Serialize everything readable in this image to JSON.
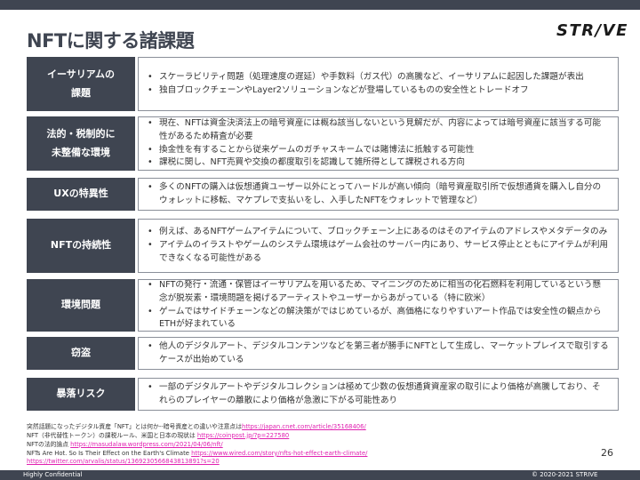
{
  "header": {
    "title": "NFTに関する諸課題",
    "logo": "STR/VE"
  },
  "rows": [
    {
      "label_lines": [
        "イーサリアムの",
        "課題"
      ],
      "bullets": [
        "スケーラビリティ問題（処理速度の遅延）や手数料（ガス代）の高騰など、イーサリアムに起因した課題が表出",
        "独自ブロックチェーンやLayer2ソリューションなどが登場しているものの安全性とトレードオフ"
      ]
    },
    {
      "label_lines": [
        "法的・税制的に",
        "未整備な環境"
      ],
      "bullets": [
        "現在、NFTは資金決済法上の暗号資産には概ね該当しないという見解だが、内容によっては暗号資産に該当する可能性があるため精査が必要",
        "換金性を有することから従来ゲームのガチャスキームでは賭博法に抵触する可能性",
        "課税に関し、NFT売買や交換の都度取引を認識して雑所得として課税される方向"
      ]
    },
    {
      "label_lines": [
        "UXの特異性"
      ],
      "bullets": [
        "多くのNFTの購入は仮想通貨ユーザー以外にとってハードルが高い傾向（暗号資産取引所で仮想通貨を購入し自分のウォレットに移転、マケプレで支払いをし、入手したNFTをウォレットで管理など）"
      ]
    },
    {
      "label_lines": [
        "NFTの持続性"
      ],
      "bullets": [
        "例えば、あるNFTゲームアイテムについて、ブロックチェーン上にあるのはそのアイテムのアドレスやメタデータのみ",
        "アイテムのイラストやゲームのシステム環境はゲーム会社のサーバー内にあり、サービス停止とともにアイテムが利用できなくなる可能性がある"
      ]
    },
    {
      "label_lines": [
        "環境問題"
      ],
      "bullets": [
        "NFTの発行・流通・保管はイーサリアムを用いるため、マイニングのために相当の化石燃料を利用しているという懸念が脱炭素・環境問題を掲げるアーティストやユーザーからあがっている（特に欧米）",
        "ゲームではサイドチェーンなどの解決策がではじめているが、高価格になりやすいアート作品では安全性の観点からETHが好まれている"
      ]
    },
    {
      "label_lines": [
        "窃盗"
      ],
      "bullets": [
        "他人のデジタルアート、デジタルコンテンツなどを第三者が勝手にNFTとして生成し、マーケットプレイスで取引するケースが出始めている"
      ]
    },
    {
      "label_lines": [
        "暴落リスク"
      ],
      "bullets": [
        "一部のデジタルアートやデジタルコレクションは極めて少数の仮想通貨資産家の取引により価格が高騰しており、それらのプレイヤーの離散により価格が急激に下がる可能性あり"
      ]
    }
  ],
  "footnotes": [
    {
      "text": "突然話題になったデジタル資産「NFT」とは何か--暗号資産との違いや注意点は",
      "link": "https://japan.cnet.com/article/35168406/"
    },
    {
      "text": "NFT（非代替性トークン）の課税ルール、米国と日本の現状は ",
      "link": "https://coinpost.jp/?p=227580"
    },
    {
      "text": "NFTの法的論点 ",
      "link": "https://masudalaw.wordpress.com/2021/04/06/nft/"
    },
    {
      "text": "NFTs Are Hot. So Is Their Effect on the Earth's Climate ",
      "link": "https://www.wired.com/story/nfts-hot-effect-earth-climate/"
    },
    {
      "text": "",
      "link": "https://twitter.com/arvalis/status/1369230566843813891?s=20"
    }
  ],
  "page_number": "26",
  "footer": {
    "confidential": "Highly Confidential",
    "copyright": "© 2020-2021 STRIVE"
  }
}
